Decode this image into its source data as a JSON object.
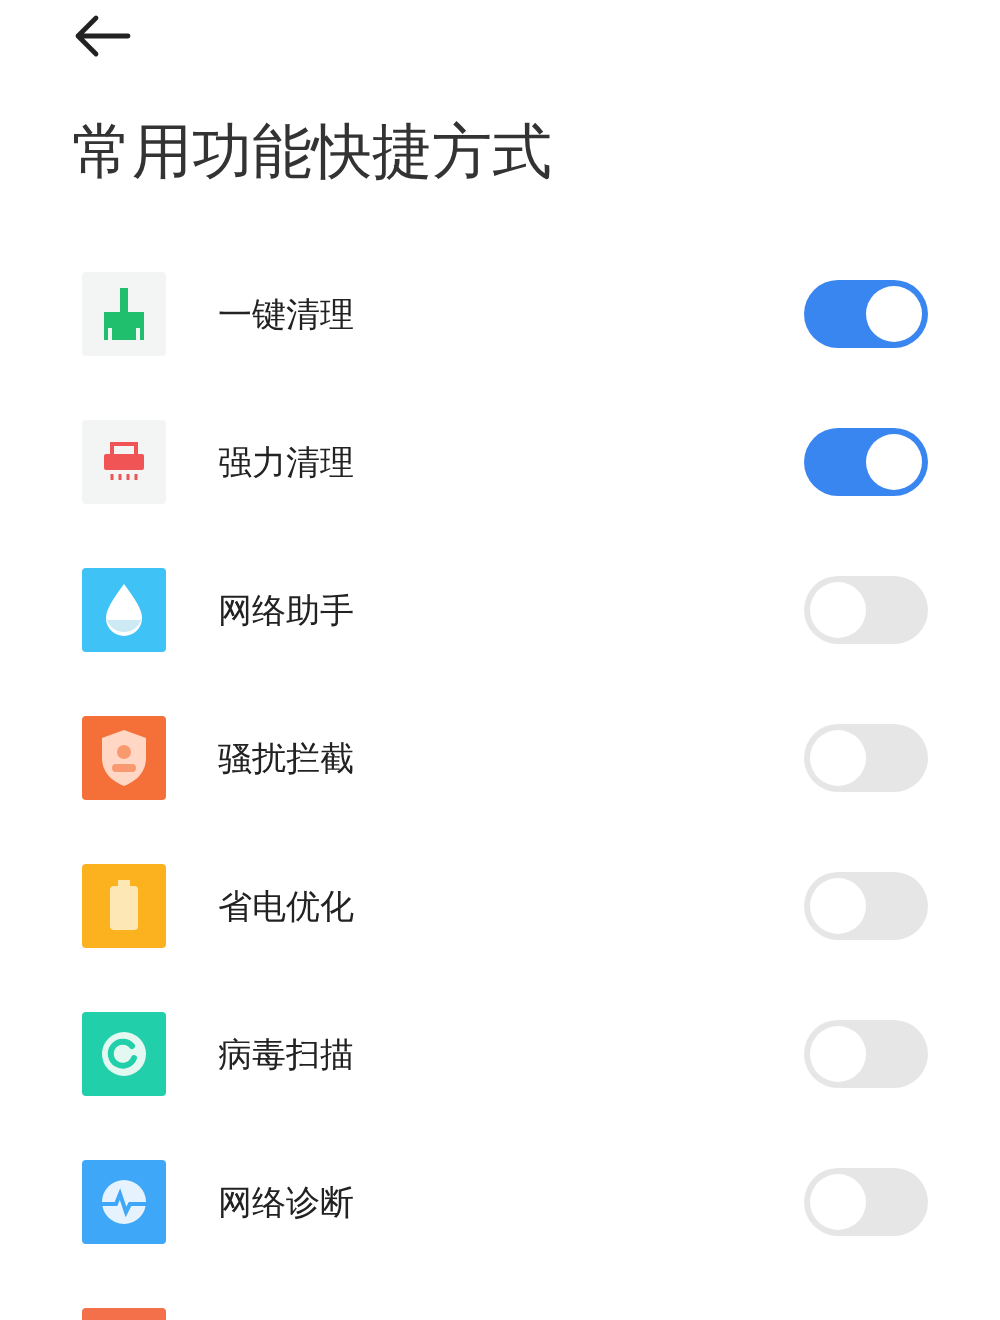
{
  "title": "常用功能快捷方式",
  "items": [
    {
      "kind": "broom",
      "label": "一键清理",
      "on": true
    },
    {
      "kind": "shredder",
      "label": "强力清理",
      "on": true
    },
    {
      "kind": "drop",
      "label": "网络助手",
      "on": false
    },
    {
      "kind": "shield",
      "label": "骚扰拦截",
      "on": false
    },
    {
      "kind": "battery",
      "label": "省电优化",
      "on": false
    },
    {
      "kind": "scan",
      "label": "病毒扫描",
      "on": false
    },
    {
      "kind": "pulse",
      "label": "网络诊断",
      "on": false
    },
    {
      "kind": "tile"
    }
  ]
}
